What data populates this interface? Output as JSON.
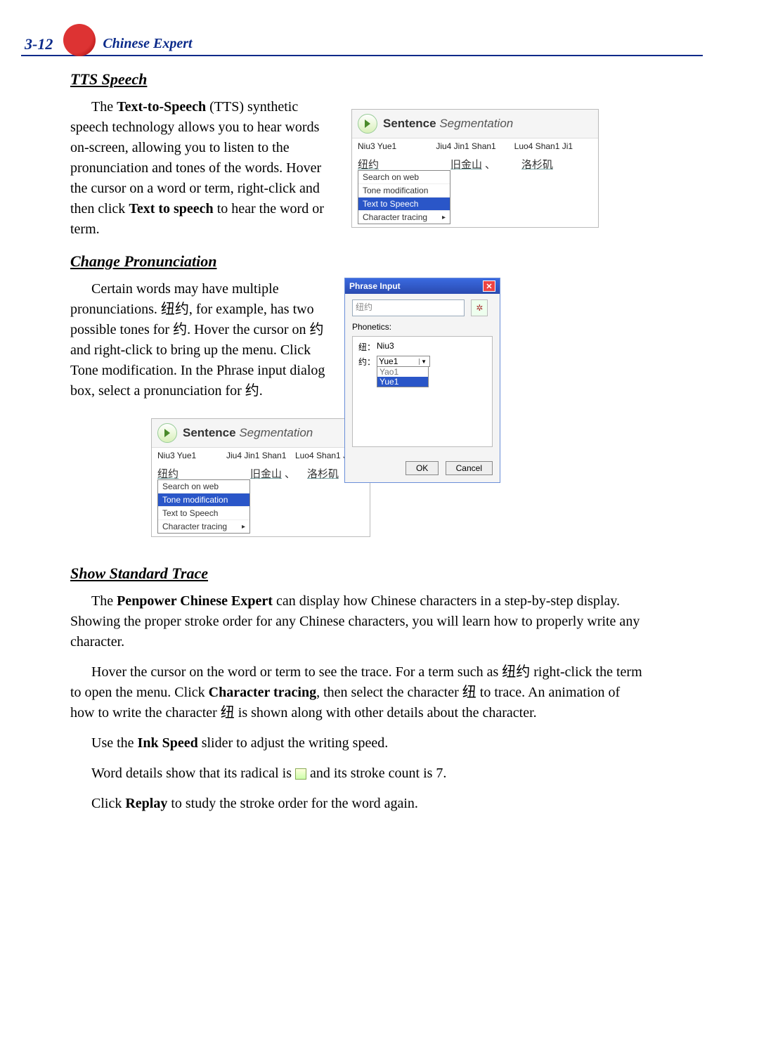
{
  "header": {
    "page_number": "3-12",
    "brand": "Chinese Expert"
  },
  "sections": {
    "tts": {
      "title": "TTS Speech",
      "para": "The Text-to-Speech (TTS) synthetic speech technology allows you to hear words on-screen, allowing you to listen to the pronunciation and tones of the words. Hover the cursor on a word or term, right-click and then click Text to speech to hear the word or term.",
      "bold1": "Text-to-Speech",
      "bold2": "Text to speech"
    },
    "change": {
      "title": "Change Pronunciation",
      "para": "Certain words may have multiple pronunciations. 纽约, for example, has two possible tones for 约. Hover the cursor on 约 and right-click to bring up the menu. Click Tone modification. In the Phrase input dialog box, select a pronunciation for 约."
    },
    "trace": {
      "title": "Show Standard Trace",
      "para1_a": "The ",
      "para1_bold": "Penpower Chinese Expert",
      "para1_b": " can display how Chinese characters in a step-by-step display. Showing the proper stroke order for any Chinese characters, you will learn how to properly write any character.",
      "para2_a": "Hover the cursor on the word or term to see the trace. For a term such as 纽约 right-click the term to open the menu. Click ",
      "para2_bold": "Character tracing",
      "para2_b": ", then select the character 纽 to trace. An animation of how to write the character 纽 is shown along with other details about the character.",
      "para3_a": "Use the ",
      "para3_bold": "Ink Speed",
      "para3_b": " slider to adjust the writing speed.",
      "para4": "Word details show that its radical is  and its stroke count is 7.",
      "para4_before": "Word details show that its radical is ",
      "para4_after": " and its stroke count is 7.",
      "para5_a": "Click ",
      "para5_bold": "Replay",
      "para5_b": " to study the stroke order for the word again."
    }
  },
  "seg_panel": {
    "title_bold": "Sentence",
    "title_rest": " Segmentation",
    "pinyin": [
      "Niu3 Yue1",
      "Jiu4 Jin1 Shan1",
      "Luo4 Shan1 Ji1"
    ],
    "hanzi": [
      "纽约",
      "旧金山",
      "洛杉矶"
    ],
    "comma": "、",
    "menu": {
      "search": "Search on web",
      "tone": "Tone modification",
      "tts": "Text to Speech",
      "trace": "Character tracing"
    }
  },
  "phrase_dialog": {
    "title": "Phrase Input",
    "field_value": "纽约",
    "phon_label": "Phonetics:",
    "rows": [
      {
        "char": "纽：",
        "value": "Niu3"
      },
      {
        "char": "约：",
        "value": "Yue1"
      }
    ],
    "options": [
      "Yao1",
      "Yue1"
    ],
    "ok": "OK",
    "cancel": "Cancel"
  }
}
